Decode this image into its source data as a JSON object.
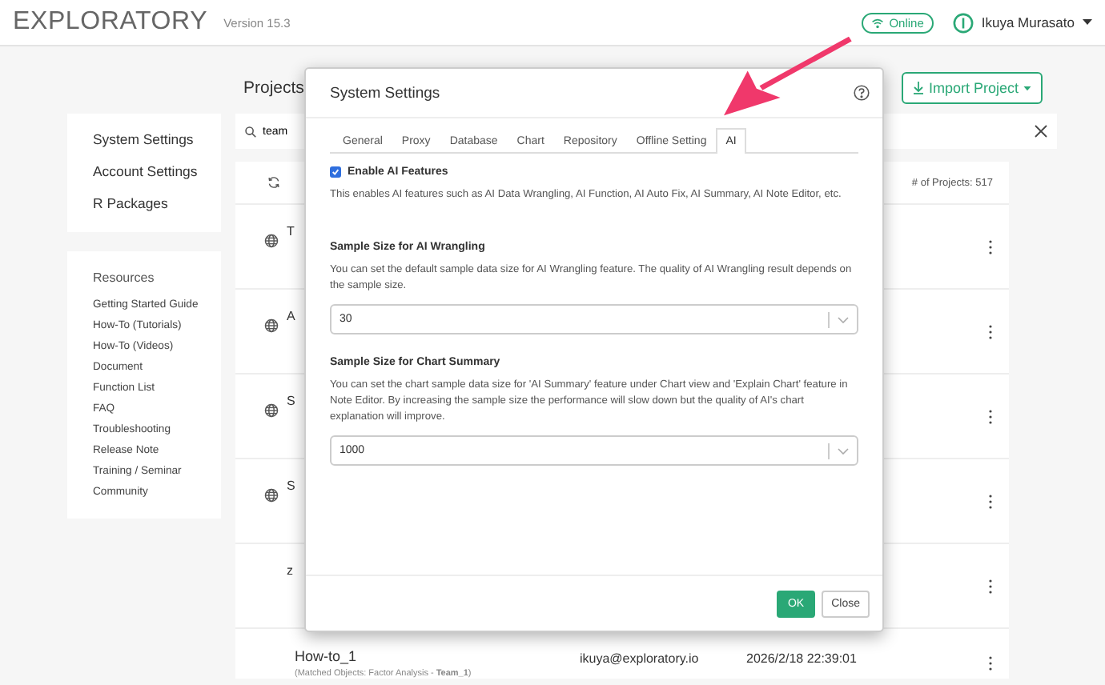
{
  "app": {
    "logo": "EXPLORATORY",
    "version": "Version 15.3",
    "status": "Online",
    "user": "Ikuya Murasato"
  },
  "sidebar": {
    "settings": [
      "System Settings",
      "Account Settings",
      "R Packages"
    ],
    "resources_title": "Resources",
    "resources": [
      "Getting Started Guide",
      "How-To (Tutorials)",
      "How-To (Videos)",
      "Document",
      "Function List",
      "FAQ",
      "Troubleshooting",
      "Release Note",
      "Training / Seminar",
      "Community"
    ]
  },
  "projects": {
    "title": "Projects",
    "import_button": "Import Project",
    "search": {
      "value": "team"
    },
    "count": "# of Projects: 517",
    "rows": [
      {
        "kind": "public",
        "title": "T"
      },
      {
        "kind": "public",
        "title": "A"
      },
      {
        "kind": "public",
        "title": "S"
      },
      {
        "kind": "public",
        "title": "S"
      },
      {
        "kind": "private",
        "title": "z"
      },
      {
        "kind": "full",
        "title": "How-to_1",
        "subtitle": "(Matched Objects: Factor Analysis - **Team_1**)",
        "owner": "ikuya@exploratory.io",
        "date": "2026/2/18 22:39:01"
      }
    ]
  },
  "dialog": {
    "title": "System Settings",
    "tabs": [
      {
        "label": "General",
        "selected": false
      },
      {
        "label": "Proxy",
        "selected": false
      },
      {
        "label": "Database",
        "selected": false
      },
      {
        "label": "Chart",
        "selected": false
      },
      {
        "label": "Repository",
        "selected": false
      },
      {
        "label": "Offline Setting",
        "selected": false
      },
      {
        "label": "AI",
        "selected": true
      }
    ],
    "enable": {
      "label": "Enable AI Features",
      "checked": true
    },
    "enable_description": "This enables AI features such as AI Data Wrangling, AI Function, AI Auto Fix, AI Summary, AI Note Editor, etc.",
    "sections": [
      {
        "heading": "Sample Size for AI Wrangling",
        "description": "You can set the default sample data size for AI Wrangling feature. The quality of AI Wrangling result depends on the sample size.",
        "value": "30"
      },
      {
        "heading": "Sample Size for Chart Summary",
        "description": "You can set the chart sample data size for 'AI Summary' feature under Chart view and 'Explain Chart' feature in Note Editor. By increasing the sample size the performance will slow down but the quality of AI's chart explanation will improve.",
        "value": "1000"
      }
    ],
    "ok_button": "OK",
    "close_button": "Close"
  }
}
